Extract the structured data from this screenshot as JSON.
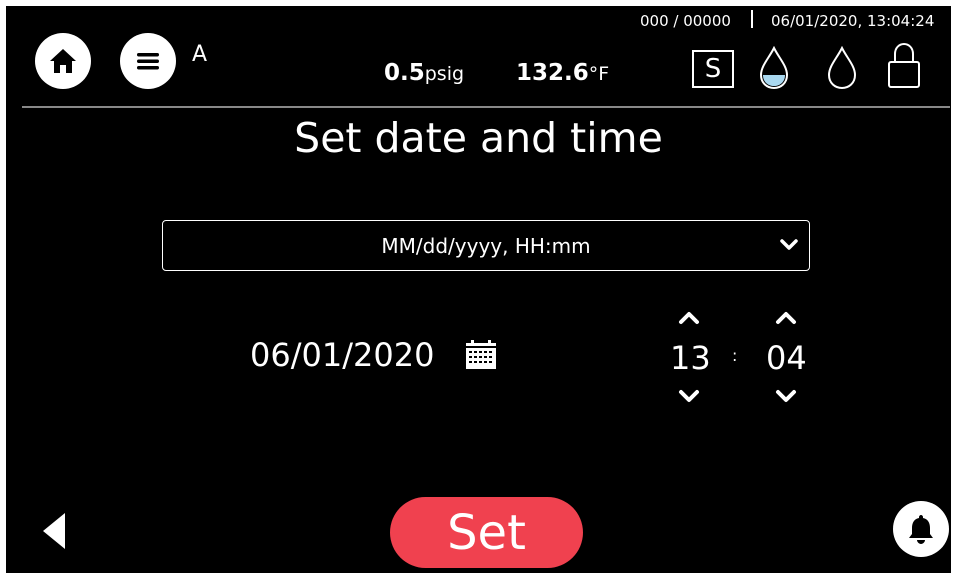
{
  "header": {
    "mode": "A",
    "counter": "000 / 00000",
    "datetime": "06/01/2020, 13:04:24",
    "pressure_value": "0.5",
    "pressure_unit": "psig",
    "temperature_value": "132.6",
    "temperature_unit": "°F",
    "status_box": "S",
    "icons": [
      "home-icon",
      "menu-icon",
      "water-drop-filled-icon",
      "water-drop-empty-icon",
      "lock-icon"
    ]
  },
  "title": "Set date and time",
  "format_select": {
    "selected": "MM/dd/yyyy, HH:mm",
    "icon": "chevron-down-icon"
  },
  "date": {
    "value": "06/01/2020",
    "icon": "calendar-icon"
  },
  "time": {
    "hour": "13",
    "separator": ":",
    "minute": "04"
  },
  "footer": {
    "set_label": "Set",
    "back_icon": "back-triangle-icon",
    "bell_icon": "bell-icon"
  },
  "colors": {
    "background": "#000000",
    "text": "#ffffff",
    "set_button": "#f0414f",
    "water_fill": "#a9d8f0"
  }
}
